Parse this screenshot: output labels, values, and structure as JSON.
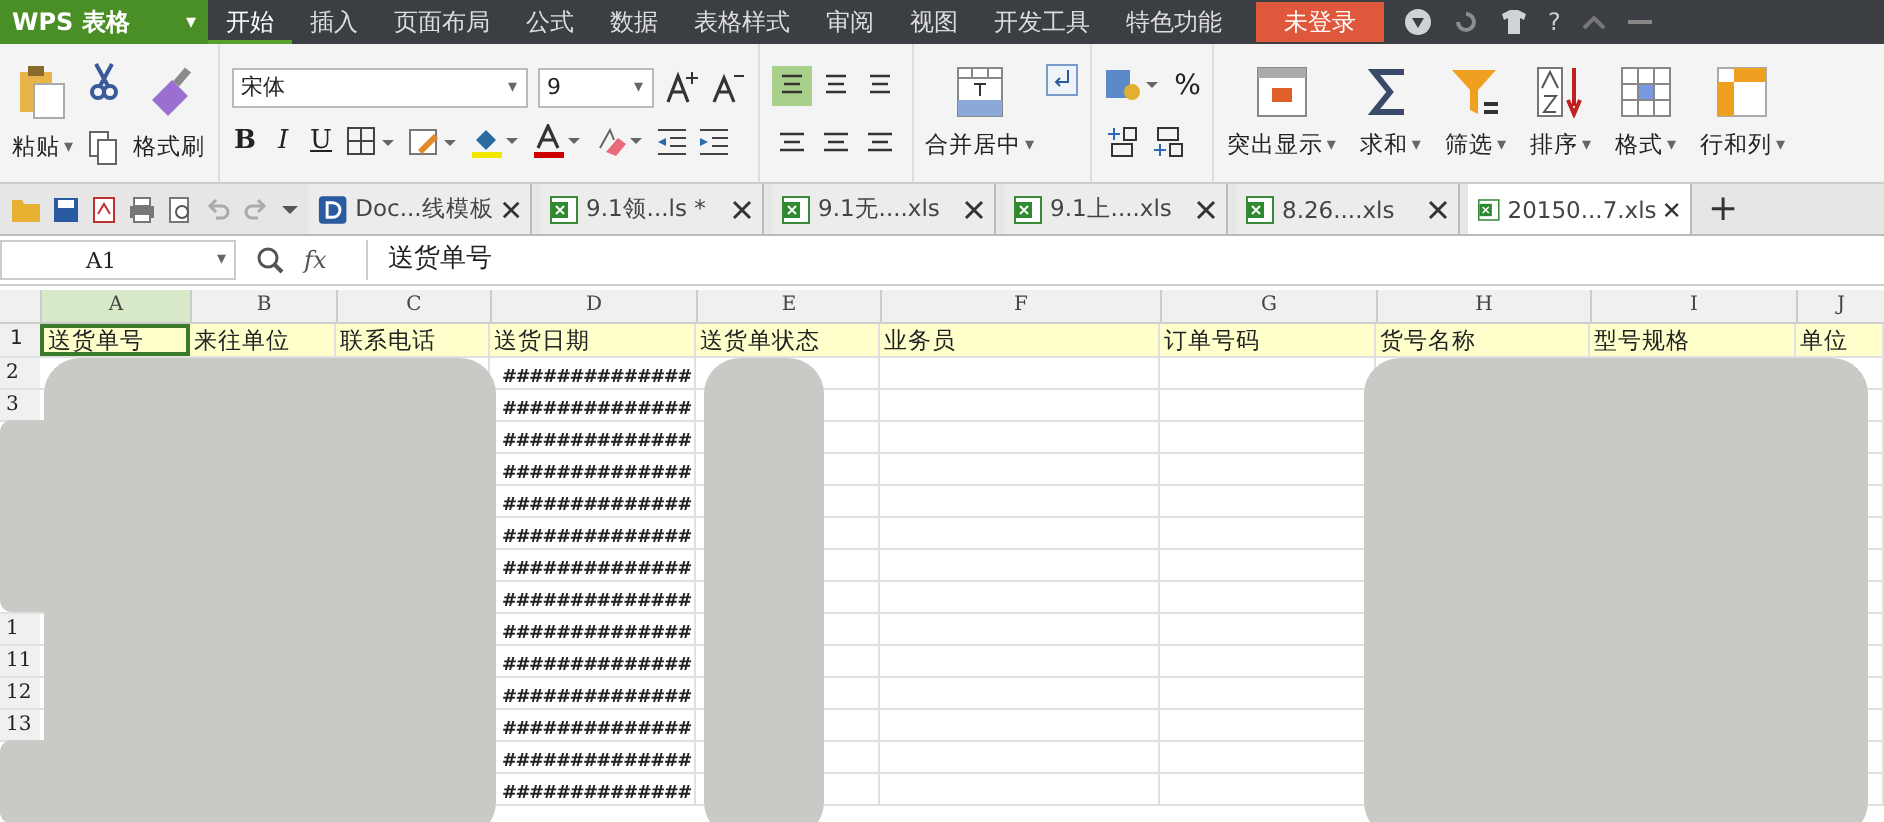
{
  "app": {
    "logo": "WPS 表格",
    "menu_caret": "▾"
  },
  "menu_tabs": [
    {
      "label": "开始",
      "selected": true
    },
    {
      "label": "插入",
      "selected": false
    },
    {
      "label": "页面布局",
      "selected": false
    },
    {
      "label": "公式",
      "selected": false
    },
    {
      "label": "数据",
      "selected": false
    },
    {
      "label": "表格样式",
      "selected": false
    },
    {
      "label": "审阅",
      "selected": false
    },
    {
      "label": "视图",
      "selected": false
    },
    {
      "label": "开发工具",
      "selected": false
    },
    {
      "label": "特色功能",
      "selected": false
    }
  ],
  "login_button": "未登录",
  "help": "?",
  "caret": "▾",
  "ribbon": {
    "paste": "粘贴",
    "format_painter": "格式刷",
    "font_name": "宋体",
    "font_size": "9",
    "bold": "B",
    "italic": "I",
    "underline": "U",
    "merge": "合并居中",
    "percent": "%",
    "tools": [
      {
        "label": "突出显示",
        "kind": "highlight"
      },
      {
        "label": "求和",
        "kind": "sum"
      },
      {
        "label": "筛选",
        "kind": "filter"
      },
      {
        "label": "排序",
        "kind": "sort"
      },
      {
        "label": "格式",
        "kind": "format"
      },
      {
        "label": "行和列",
        "kind": "rowcol"
      }
    ]
  },
  "doc_tabs": [
    {
      "label": "Doc...线模板",
      "kind": "doc",
      "selected": false
    },
    {
      "label": "9.1领...ls *",
      "kind": "sheet",
      "selected": false
    },
    {
      "label": "9.1无....xls",
      "kind": "sheet",
      "selected": false
    },
    {
      "label": "9.1上....xls",
      "kind": "sheet",
      "selected": false
    },
    {
      "label": "8.26....xls",
      "kind": "sheet",
      "selected": false
    },
    {
      "label": "20150...7.xls",
      "kind": "sheet",
      "selected": true
    }
  ],
  "new_tab": "+",
  "formula_bar": {
    "cell_ref": "A1",
    "fx": "fx",
    "value": "送货单号"
  },
  "grid": {
    "columns": [
      {
        "letter": "A",
        "selected": true
      },
      {
        "letter": "B",
        "selected": false
      },
      {
        "letter": "C",
        "selected": false
      },
      {
        "letter": "D",
        "selected": false
      },
      {
        "letter": "E",
        "selected": false
      },
      {
        "letter": "F",
        "selected": false
      },
      {
        "letter": "G",
        "selected": false
      },
      {
        "letter": "H",
        "selected": false
      },
      {
        "letter": "I",
        "selected": false
      },
      {
        "letter": "J",
        "selected": false
      }
    ],
    "header_row": {
      "number": "1",
      "cells": [
        "送货单号",
        "来往单位",
        "联系电话",
        "送货日期",
        "送货单状态",
        "业务员",
        "订单号码",
        "货号名称",
        "型号规格",
        "单位"
      ]
    },
    "rows": [
      {
        "number": "2",
        "date": "##############"
      },
      {
        "number": "3",
        "date": "##############"
      },
      {
        "date": "##############"
      },
      {
        "date": "##############"
      },
      {
        "date": "##############"
      },
      {
        "date": "##############"
      },
      {
        "date": "##############"
      },
      {
        "date": "##############"
      },
      {
        "number": "1",
        "date": "##############"
      },
      {
        "number": "11",
        "date": "##############"
      },
      {
        "number": "12",
        "date": "##############"
      },
      {
        "number": "13",
        "date": "##############"
      },
      {
        "date": "##############"
      },
      {
        "date": "##############"
      }
    ]
  }
}
